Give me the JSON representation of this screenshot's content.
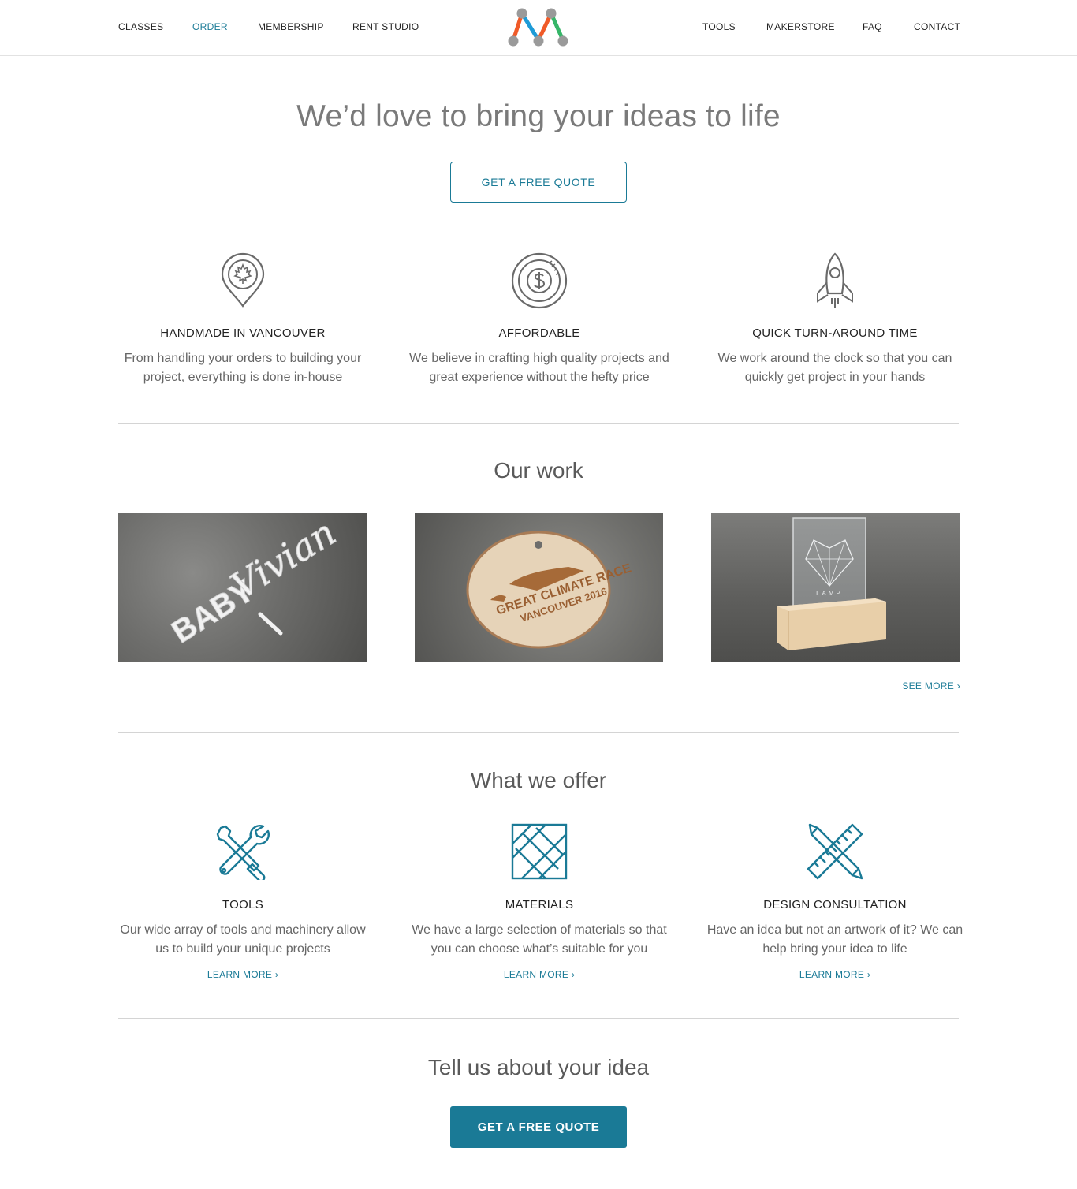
{
  "nav": {
    "left": [
      "CLASSES",
      "ORDER",
      "MEMBERSHIP",
      "RENT STUDIO"
    ],
    "right": [
      "TOOLS",
      "MAKERSTORE",
      "FAQ",
      "CONTACT"
    ],
    "active": "ORDER",
    "logo_colors": [
      "#f05a28",
      "#1d9bd7",
      "#35b668",
      "#9a9a9a"
    ]
  },
  "hero": {
    "title": "We’d love to bring your ideas to life",
    "cta": "GET A FREE QUOTE"
  },
  "features": [
    {
      "icon": "maple-leaf-pin-icon",
      "title": "HANDMADE IN VANCOUVER",
      "text": "From handling your orders to building your project, everything is done in-house"
    },
    {
      "icon": "dollar-coin-icon",
      "title": "AFFORDABLE",
      "text": "We believe in crafting high quality projects and great experience without the hefty price"
    },
    {
      "icon": "rocket-icon",
      "title": "QUICK TURN-AROUND TIME",
      "text": "We work around the clock so that you can quickly get project in your hands"
    }
  ],
  "work": {
    "title": "Our work",
    "images": [
      {
        "alt_text_visible": "BABY Vivian"
      },
      {
        "alt_text_visible": "THE GREAT CLIMATE RACE VANCOUVER 2016"
      },
      {
        "alt_text_visible": "LAMP"
      }
    ],
    "see_more": "SEE MORE ›"
  },
  "offer": {
    "title": "What we offer",
    "items": [
      {
        "icon": "tools-icon",
        "title": "TOOLS",
        "text": "Our wide array of tools and machinery allow us to build your unique projects",
        "link": "LEARN MORE ›"
      },
      {
        "icon": "materials-icon",
        "title": "MATERIALS",
        "text": "We have a large selection of materials so that you can choose what’s suitable for you",
        "link": "LEARN MORE ›"
      },
      {
        "icon": "pencil-ruler-icon",
        "title": "DESIGN CONSULTATION",
        "text": "Have an idea but not an artwork of it? We can help bring your idea to life",
        "link": "LEARN MORE ›"
      }
    ]
  },
  "bottom": {
    "title": "Tell us about your idea",
    "cta": "GET A FREE QUOTE"
  },
  "colors": {
    "accent": "#1a7a96",
    "text": "#4a4a4a",
    "muted": "#666666"
  }
}
